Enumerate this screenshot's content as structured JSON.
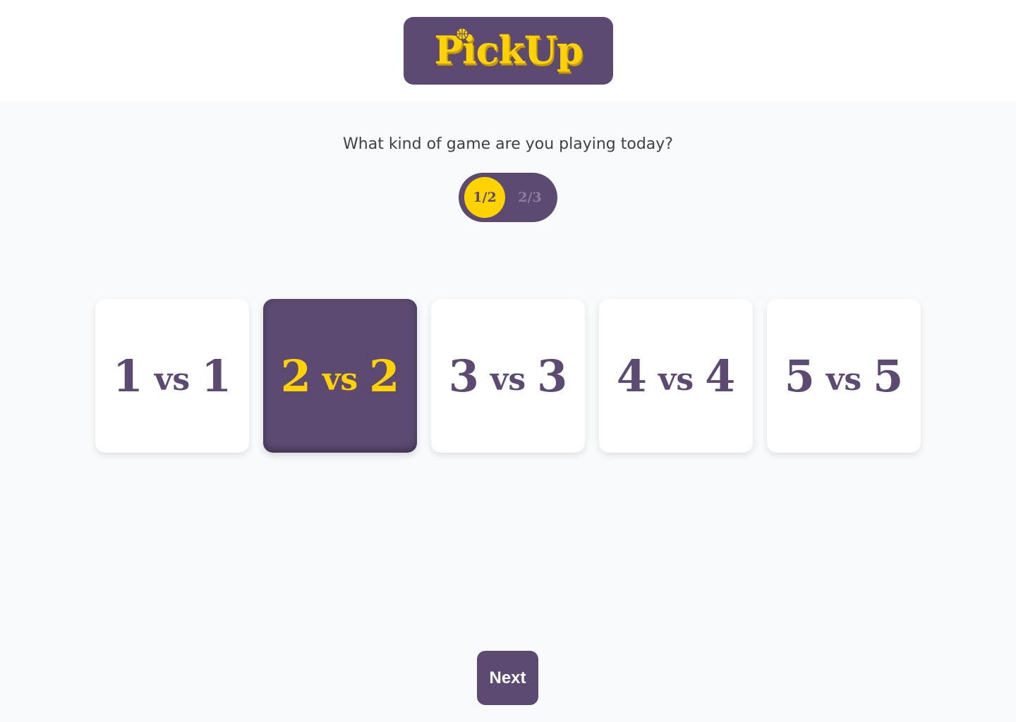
{
  "header": {
    "logo_text": "PickUp",
    "logo_icon": "basketball-icon"
  },
  "main": {
    "question": "What kind of game are you playing today?",
    "stepper": {
      "current": "1/2",
      "next": "2/3"
    },
    "options": [
      {
        "left": "1",
        "vs": "vs",
        "right": "1",
        "selected": false
      },
      {
        "left": "2",
        "vs": "vs",
        "right": "2",
        "selected": true
      },
      {
        "left": "3",
        "vs": "vs",
        "right": "3",
        "selected": false
      },
      {
        "left": "4",
        "vs": "vs",
        "right": "4",
        "selected": false
      },
      {
        "left": "5",
        "vs": "vs",
        "right": "5",
        "selected": false
      }
    ],
    "next_label": "Next"
  },
  "colors": {
    "brand_purple": "#5c4a72",
    "brand_yellow": "#ffd200",
    "background": "#f9fafb"
  }
}
